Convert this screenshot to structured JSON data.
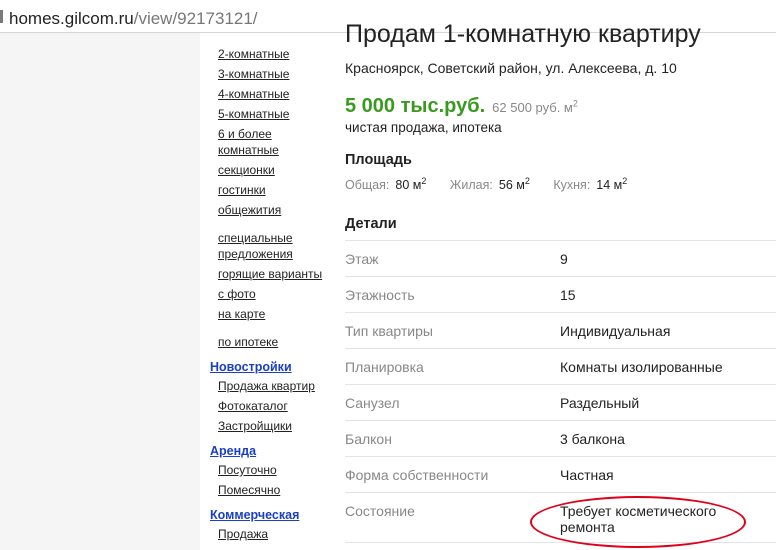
{
  "browser": {
    "url_host": "homes.gilcom.ru",
    "url_path": "/view/92173121/"
  },
  "sidebar": {
    "rooms_links": [
      "2-комнатные",
      "3-комнатные",
      "4-комнатные",
      "5-комнатные",
      "6 и более",
      "комнатные",
      "секционки",
      "гостинки",
      "общежития"
    ],
    "special_links": [
      "специальные",
      "предложения",
      "горящие варианты",
      "с фото",
      "на карте"
    ],
    "mortgage_link": "по ипотеке",
    "sections": [
      {
        "title": "Новостройки",
        "items": [
          "Продажа квартир",
          "Фотокаталог",
          "Застройщики"
        ]
      },
      {
        "title": "Аренда",
        "items": [
          "Посуточно",
          "Помесячно"
        ]
      },
      {
        "title": "Коммерческая",
        "items": [
          "Продажа"
        ]
      }
    ]
  },
  "listing": {
    "title": "Продам 1-комнатную квартиру",
    "address": "Красноярск, Советский район, ул. Алексеева, д. 10",
    "price": "5 000 тыс.руб.",
    "price_per_unit": "62 500 руб. м",
    "price_per_unit_sup": "2",
    "deal": "чистая продажа, ипотека",
    "area_heading": "Площадь",
    "areas": [
      {
        "label": "Общая:",
        "value": "80 м",
        "sup": "2"
      },
      {
        "label": "Жилая:",
        "value": "56 м",
        "sup": "2"
      },
      {
        "label": "Кухня:",
        "value": "14 м",
        "sup": "2"
      }
    ],
    "details_heading": "Детали",
    "details": [
      {
        "key": "Этаж",
        "value": "9"
      },
      {
        "key": "Этажность",
        "value": "15"
      },
      {
        "key": "Тип квартиры",
        "value": "Индивидуальная"
      },
      {
        "key": "Планировка",
        "value": "Комнаты изолированные"
      },
      {
        "key": "Санузел",
        "value": "Раздельный"
      },
      {
        "key": "Балкон",
        "value": "3 балкона"
      },
      {
        "key": "Форма собственности",
        "value": "Частная"
      },
      {
        "key": "Состояние",
        "value": "Требует косметического ремонта"
      }
    ]
  },
  "colors": {
    "price_green": "#3a9a1f",
    "section_link_blue": "#1a3fc7",
    "annotation_red": "#e0001b"
  }
}
